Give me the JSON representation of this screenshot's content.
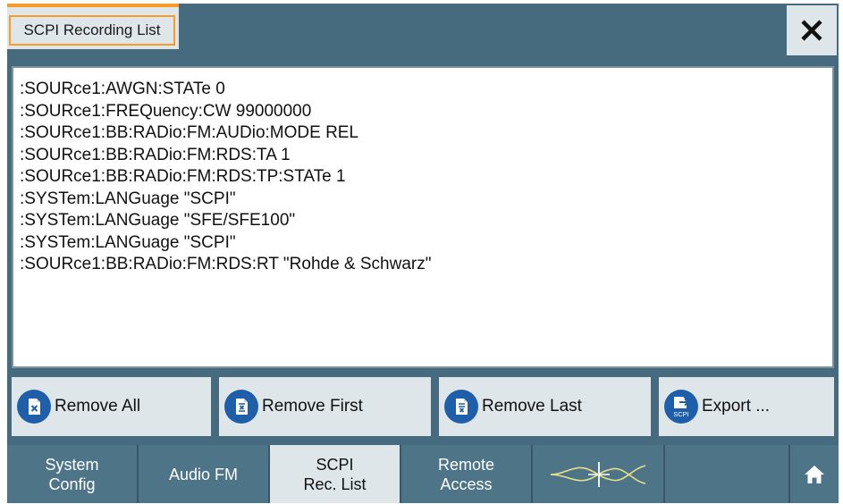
{
  "window": {
    "title": "SCPI Recording List",
    "close_icon": "close-x-icon"
  },
  "recording_list": {
    "lines": [
      ":SOURce1:AWGN:STATe 0",
      ":SOURce1:FREQuency:CW 99000000",
      ":SOURce1:BB:RADio:FM:AUDio:MODE REL",
      ":SOURce1:BB:RADio:FM:RDS:TA 1",
      ":SOURce1:BB:RADio:FM:RDS:TP:STATe 1",
      ":SYSTem:LANGuage \"SCPI\"",
      ":SYSTem:LANGuage \"SFE/SFE100\"",
      ":SYSTem:LANGuage \"SCPI\"",
      ":SOURce1:BB:RADio:FM:RDS:RT \"Rohde & Schwarz\""
    ]
  },
  "actions": {
    "remove_all": "Remove All",
    "remove_first": "Remove First",
    "remove_last": "Remove Last",
    "export": "Export ...",
    "export_icon_text": "SCPI"
  },
  "nav": {
    "system_config": [
      "System",
      "Config"
    ],
    "audio_fm": "Audio FM",
    "scpi_rec_list": [
      "SCPI",
      "Rec. List"
    ],
    "remote_access": [
      "Remote",
      "Access"
    ],
    "signal_icon": "signal-waveform-icon",
    "home_icon": "home-icon"
  },
  "colors": {
    "accent": "#f59b2a",
    "header_bg": "#466a7e",
    "nav_bg": "#4e7487",
    "button_bg": "#dfe6ea",
    "icon_blue": "#1f5ea8",
    "waveform": "#e6e08a"
  }
}
